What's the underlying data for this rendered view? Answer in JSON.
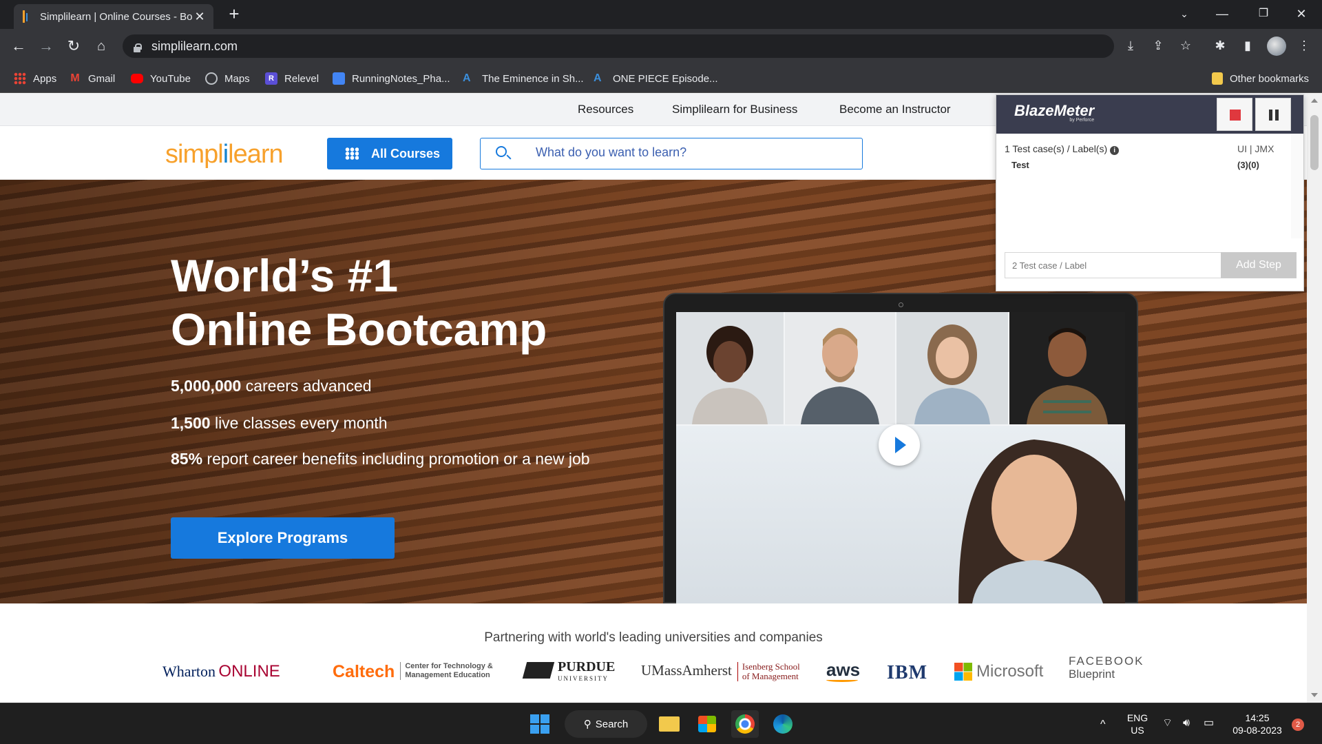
{
  "browser": {
    "tab_title": "Simplilearn | Online Courses - Bo",
    "url": "simplilearn.com",
    "bookmarks": [
      "Apps",
      "Gmail",
      "YouTube",
      "Maps",
      "Relevel",
      "RunningNotes_Pha...",
      "The Eminence in Sh...",
      "ONE PIECE Episode..."
    ],
    "other_bookmarks": "Other bookmarks"
  },
  "site": {
    "topnav": [
      "Resources",
      "Simplilearn for Business",
      "Become an Instructor"
    ],
    "logo_a": "simpl",
    "logo_b": "i",
    "logo_c": "learn",
    "all_courses": "All Courses",
    "search_placeholder": "What do you want to learn?",
    "hero_line1": "World’s #1",
    "hero_line2": "Online Bootcamp",
    "stats": [
      {
        "num": "5,000,000",
        "text": " careers advanced"
      },
      {
        "num": "1,500",
        "text": " live classes every month"
      },
      {
        "num": "85%",
        "text": " report career benefits including promotion or a new job"
      }
    ],
    "explore_button": "Explore Programs",
    "partner_heading": "Partnering with world's leading universities and companies",
    "partners": {
      "wharton": "Wharton",
      "wharton_online": "ONLINE",
      "caltech": "Caltech",
      "caltech_sub1": "Center for Technology &",
      "caltech_sub2": "Management Education",
      "purdue": "PURDUE",
      "purdue_sub": "UNIVERSITY",
      "umass": "UMassAmherst",
      "isenberg1": "Isenberg School",
      "isenberg2": "of Management",
      "aws": "aws",
      "ibm": "IBM",
      "microsoft": "Microsoft",
      "facebook1": "FACEBOOK",
      "facebook2": "Blueprint"
    }
  },
  "blazemeter": {
    "logo": "BlazeMeter",
    "logo_sub": "by Perforce",
    "summary": "1 Test case(s) / Label(s)",
    "mode": "UI | JMX",
    "test_name": "Test",
    "test_count": "(3)(0)",
    "input_placeholder": "2 Test case / Label",
    "add_step": "Add Step"
  },
  "taskbar": {
    "search": "Search",
    "lang1": "ENG",
    "lang2": "US",
    "time": "14:25",
    "date": "09-08-2023",
    "notif_count": "2"
  }
}
